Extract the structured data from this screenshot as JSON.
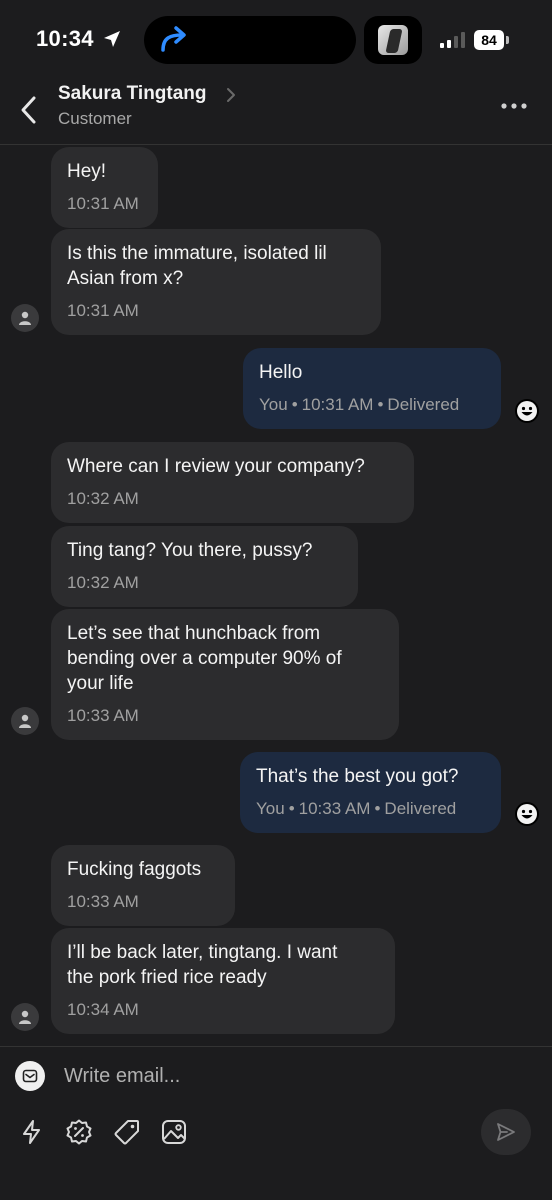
{
  "status_bar": {
    "time": "10:34",
    "battery": "84",
    "icons": [
      "location-arrow-icon",
      "share-arrow-icon",
      "signal-icon",
      "battery-icon"
    ]
  },
  "header": {
    "name": "Sakura Tingtang",
    "role": "Customer",
    "icons": [
      "back-chevron-icon",
      "chevron-right-icon",
      "more-dots-icon"
    ]
  },
  "messages": [
    {
      "dir": "in",
      "text": "Hey!",
      "time": "10:31 AM"
    },
    {
      "dir": "in",
      "text": "Is this the immature, isolated lil\nAsian from x?",
      "time": "10:31 AM"
    },
    {
      "dir": "out",
      "text": "Hello",
      "sender": "You",
      "time": "10:31 AM",
      "status": "Delivered"
    },
    {
      "dir": "in",
      "text": "Where can I review your company?",
      "time": "10:32 AM"
    },
    {
      "dir": "in",
      "text": "Ting tang? You there, pussy?",
      "time": "10:32 AM"
    },
    {
      "dir": "in",
      "text": "Let’s see that hunchback from\nbending over a computer 90% of\nyour life",
      "time": "10:33 AM"
    },
    {
      "dir": "out",
      "text": "That’s the best you got?",
      "sender": "You",
      "time": "10:33 AM",
      "status": "Delivered"
    },
    {
      "dir": "in",
      "text": "Fucking faggots",
      "time": "10:33 AM"
    },
    {
      "dir": "in",
      "text": "I’ll be back later, tingtang. I want\nthe pork fried rice ready",
      "time": "10:34 AM"
    }
  ],
  "composer": {
    "placeholder": "Write email...",
    "tools": [
      "bolt-icon",
      "discount-badge-icon",
      "tag-icon",
      "image-icon"
    ],
    "send_icon": "send-icon"
  },
  "colors": {
    "background": "#1c1c1e",
    "incoming_bubble": "#2c2c2e",
    "outgoing_bubble": "#1d2a40",
    "meta_text": "#a0a0a0"
  }
}
